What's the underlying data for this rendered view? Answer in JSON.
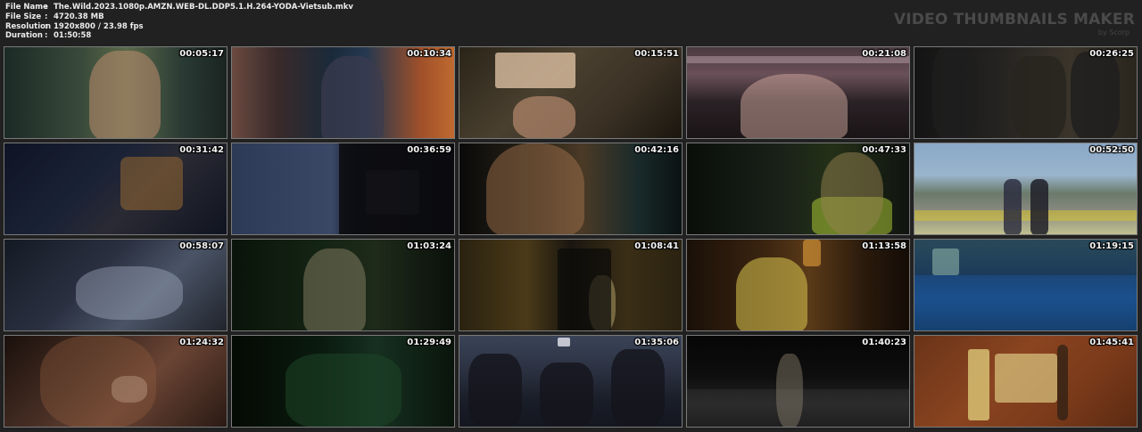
{
  "file_info": {
    "rows": [
      {
        "key": "File Name",
        "value": "The.Wild.2023.1080p.AMZN.WEB-DL.DDP5.1.H.264-YODA-Vietsub.mkv"
      },
      {
        "key": "File Size",
        "value": "4720.38 MB"
      },
      {
        "key": "Resolution",
        "value": "1920x800 / 23.98 fps"
      },
      {
        "key": "Duration",
        "value": "01:50:58"
      }
    ],
    "separator": ":"
  },
  "brand": {
    "title": "VIDEO THUMBNAILS MAKER",
    "subtitle": "by Scorp"
  },
  "thumbnails": [
    {
      "time": "00:05:17",
      "bg": "linear-gradient(90deg,#1c2a26 0%,#3a4a3a 35%,#5a6a4a 55%,#2a3a34 80%,#1a2420 100%)"
    },
    {
      "time": "00:10:34",
      "bg": "linear-gradient(90deg,#6a4a40 0%,#3a2a2a 20%,#1a2a3a 45%,#243850 60%,#a0502a 85%,#c06a30 100%)"
    },
    {
      "time": "00:15:51",
      "bg": "linear-gradient(135deg,#2a2418 0%,#4a4030 40%,#3a3024 70%,#1a160e 100%)"
    },
    {
      "time": "00:21:08",
      "bg": "linear-gradient(180deg,#4a3a40 0%,#6a5058 30%,#2a2226 60%,#1a1416 100%)"
    },
    {
      "time": "00:26:25",
      "bg": "linear-gradient(90deg,#141414 0%,#262422 40%,#3a342a 70%,#2a261e 100%)"
    },
    {
      "time": "00:31:42",
      "bg": "linear-gradient(135deg,#0e1424 0%,#1a2236 40%,#2a2a34 60%,#101420 100%)"
    },
    {
      "time": "00:36:59",
      "bg": "linear-gradient(90deg,#2c3a56 0%,#3a4866 45%,#1a1e2a 55%,#0e1016 100%)"
    },
    {
      "time": "00:42:16",
      "bg": "linear-gradient(90deg,#0a0a0a 0%,#2a2418 35%,#4a3a26 55%,#1a2a2a 80%,#0a1212 100%)"
    },
    {
      "time": "00:47:33",
      "bg": "linear-gradient(90deg,#0a0e0a 0%,#182018 40%,#243018 65%,#101410 100%)"
    },
    {
      "time": "00:52:50",
      "bg": "linear-gradient(180deg,#8aa8c8 0%,#9ab4cc 35%,#6a7a6a 55%,#8a8a80 75%,#c0c090 100%)"
    },
    {
      "time": "00:58:07",
      "bg": "linear-gradient(135deg,#141a24 0%,#2a3040 40%,#4a5466 65%,#20242c 100%)"
    },
    {
      "time": "01:03:24",
      "bg": "linear-gradient(90deg,#0a140a 0%,#142414 40%,#1e2a1a 65%,#0a100a 100%)"
    },
    {
      "time": "01:08:41",
      "bg": "linear-gradient(90deg,#2a2210 0%,#4a3a18 30%,#1a1610 50%,#3a2e16 75%,#2a2210 100%)"
    },
    {
      "time": "01:13:58",
      "bg": "linear-gradient(90deg,#1a1008 0%,#3a2410 35%,#5a3a18 55%,#2a1a0c 80%,#140c06 100%)"
    },
    {
      "time": "01:19:15",
      "bg": "linear-gradient(180deg,#2a4a5a 0%,#1a3a5a 40%,#1a4a7a 65%,#10304a 100%)"
    },
    {
      "time": "01:24:32",
      "bg": "linear-gradient(135deg,#1a100c 0%,#4a3026 40%,#6a4434 60%,#2a1a14 100%)"
    },
    {
      "time": "01:29:49",
      "bg": "linear-gradient(90deg,#040a04 0%,#0a1a0e 40%,#163020 65%,#0a140c 100%)"
    },
    {
      "time": "01:35:06",
      "bg": "linear-gradient(180deg,#3a4458 0%,#2a3040 40%,#1a1e28 70%,#141620 100%)"
    },
    {
      "time": "01:40:23",
      "bg": "linear-gradient(180deg,#060606 0%,#0e0e0e 45%,#242424 75%,#101010 100%)"
    },
    {
      "time": "01:45:41",
      "bg": "linear-gradient(135deg,#6a3418 0%,#8a4420 40%,#7a3a1a 70%,#5a2a12 100%)"
    }
  ]
}
